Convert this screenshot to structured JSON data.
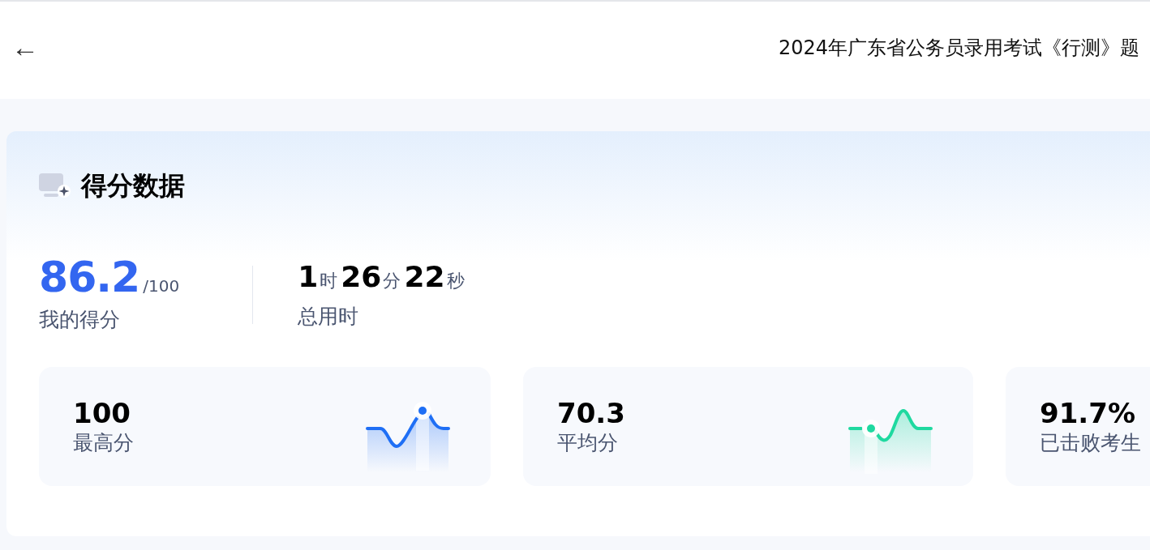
{
  "header": {
    "back": "←",
    "title": "2024年广东省公务员录用考试《行测》题"
  },
  "section": {
    "title": "得分数据"
  },
  "score": {
    "value": "86.2",
    "total": "/100",
    "label": "我的得分"
  },
  "duration": {
    "parts": [
      {
        "number": "1",
        "unit": "时"
      },
      {
        "number": "26",
        "unit": "分"
      },
      {
        "number": "22",
        "unit": "秒"
      }
    ],
    "label": "总用时"
  },
  "stats": [
    {
      "value": "100",
      "label": "最高分",
      "color": "#1f6ff5"
    },
    {
      "value": "70.3",
      "label": "平均分",
      "color": "#1fd9a0"
    },
    {
      "value": "91.7%",
      "label": "已击败考生"
    }
  ]
}
